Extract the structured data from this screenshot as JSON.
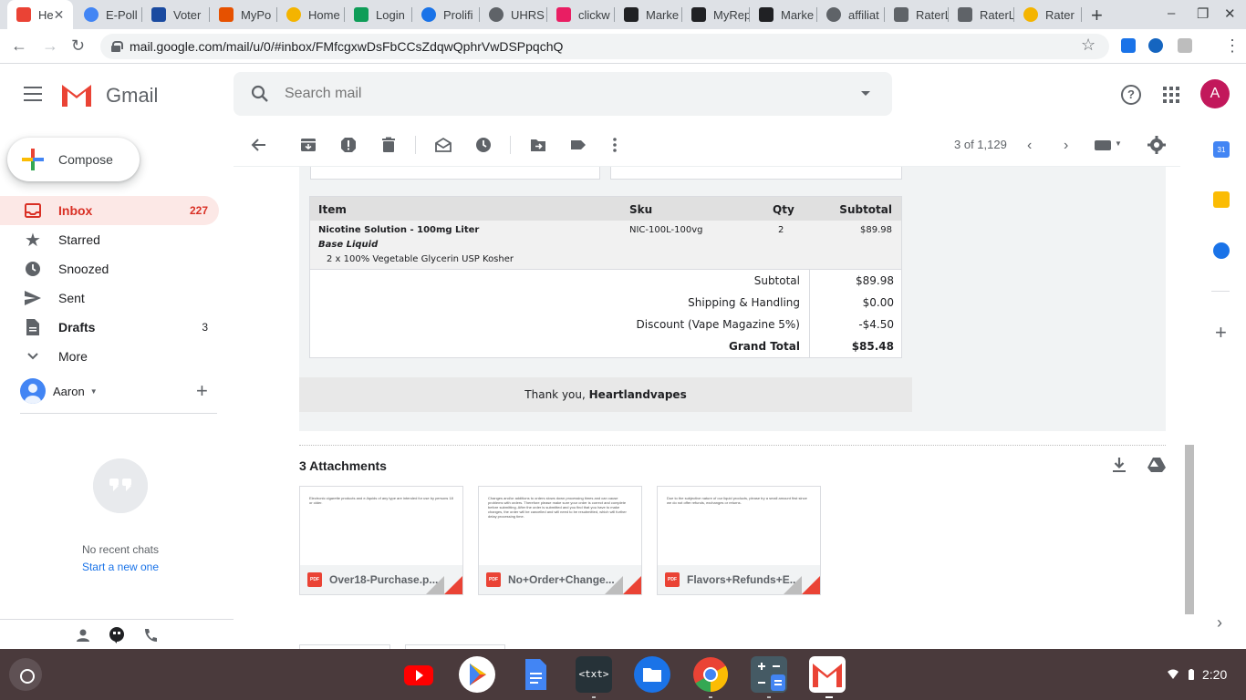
{
  "browser": {
    "tabs": [
      {
        "title": "He",
        "color": "#ea4335"
      },
      {
        "title": "E-Poll",
        "color": "#4285f4"
      },
      {
        "title": "Voter",
        "color": "#1a4aa0"
      },
      {
        "title": "MyPo",
        "color": "#e65100"
      },
      {
        "title": "Home",
        "color": "#f4b400"
      },
      {
        "title": "Login",
        "color": "#0f9d58"
      },
      {
        "title": "Prolifi",
        "color": "#1a73e8"
      },
      {
        "title": "UHRS",
        "color": "#5f6368"
      },
      {
        "title": "clickw",
        "color": "#e91e63"
      },
      {
        "title": "Marke",
        "color": "#202124"
      },
      {
        "title": "MyRep",
        "color": "#202124"
      },
      {
        "title": "Marke",
        "color": "#202124"
      },
      {
        "title": "affiliat",
        "color": "#5f6368"
      },
      {
        "title": "RaterL",
        "color": "#5f6368"
      },
      {
        "title": "RaterL",
        "color": "#5f6368"
      },
      {
        "title": "Rater",
        "color": "#f4b400"
      }
    ],
    "url": "mail.google.com/mail/u/0/#inbox/FMfcgxwDsFbCCsZdqwQphrVwDSPpqchQ"
  },
  "gmail": {
    "brand": "Gmail",
    "search_placeholder": "Search mail",
    "avatar_letter": "A",
    "compose_label": "Compose",
    "nav": [
      {
        "label": "Inbox",
        "count": "227",
        "icon": "inbox-icon"
      },
      {
        "label": "Starred",
        "count": "",
        "icon": "star-icon"
      },
      {
        "label": "Snoozed",
        "count": "",
        "icon": "clock-icon"
      },
      {
        "label": "Sent",
        "count": "",
        "icon": "send-icon"
      },
      {
        "label": "Drafts",
        "count": "3",
        "icon": "draft-icon"
      },
      {
        "label": "More",
        "count": "",
        "icon": "chevron-down-icon"
      }
    ],
    "hangouts_user": "Aaron",
    "no_chats": "No recent chats",
    "start_chat": "Start a new one",
    "pager": "3 of 1,129"
  },
  "email": {
    "table_headers": [
      "Item",
      "Sku",
      "Qty",
      "Subtotal"
    ],
    "item_name": "Nicotine Solution - 100mg Liter",
    "item_option": "Base Liquid",
    "item_detail": "2 x 100% Vegetable Glycerin USP Kosher",
    "item_sku": "NIC-100L-100vg",
    "item_qty": "2",
    "item_subtotal": "$89.98",
    "totals": [
      {
        "label": "Subtotal",
        "value": "$89.98"
      },
      {
        "label": "Shipping & Handling",
        "value": "$0.00"
      },
      {
        "label": "Discount (Vape Magazine 5%)",
        "value": "-$4.50"
      },
      {
        "label": "Grand Total",
        "value": "$85.48"
      }
    ],
    "thanks_prefix": "Thank you,",
    "thanks_name": "Heartlandvapes"
  },
  "attachments": {
    "title": "3 Attachments",
    "files": [
      {
        "name": "Over18-Purchase.p...",
        "preview": "Electronic cigarette products and e-liquids of any type are intended for use by persons 18 or older."
      },
      {
        "name": "No+Order+Change...",
        "preview": "Changes and/or additions to orders slows down processing times and can cause problems with orders. Therefore please make sure your order is correct and complete before submitting. After the order is submitted and you find that you have to make changes, the order will be cancelled and will need to be resubmitted, which will further delay processing time."
      },
      {
        "name": "Flavors+Refunds+E...",
        "preview": "Due to the subjective nature of our liquid products, please try a small amount first since we do not offer refunds, exchanges or returns."
      }
    ]
  },
  "shelf": {
    "time": "2:20"
  }
}
